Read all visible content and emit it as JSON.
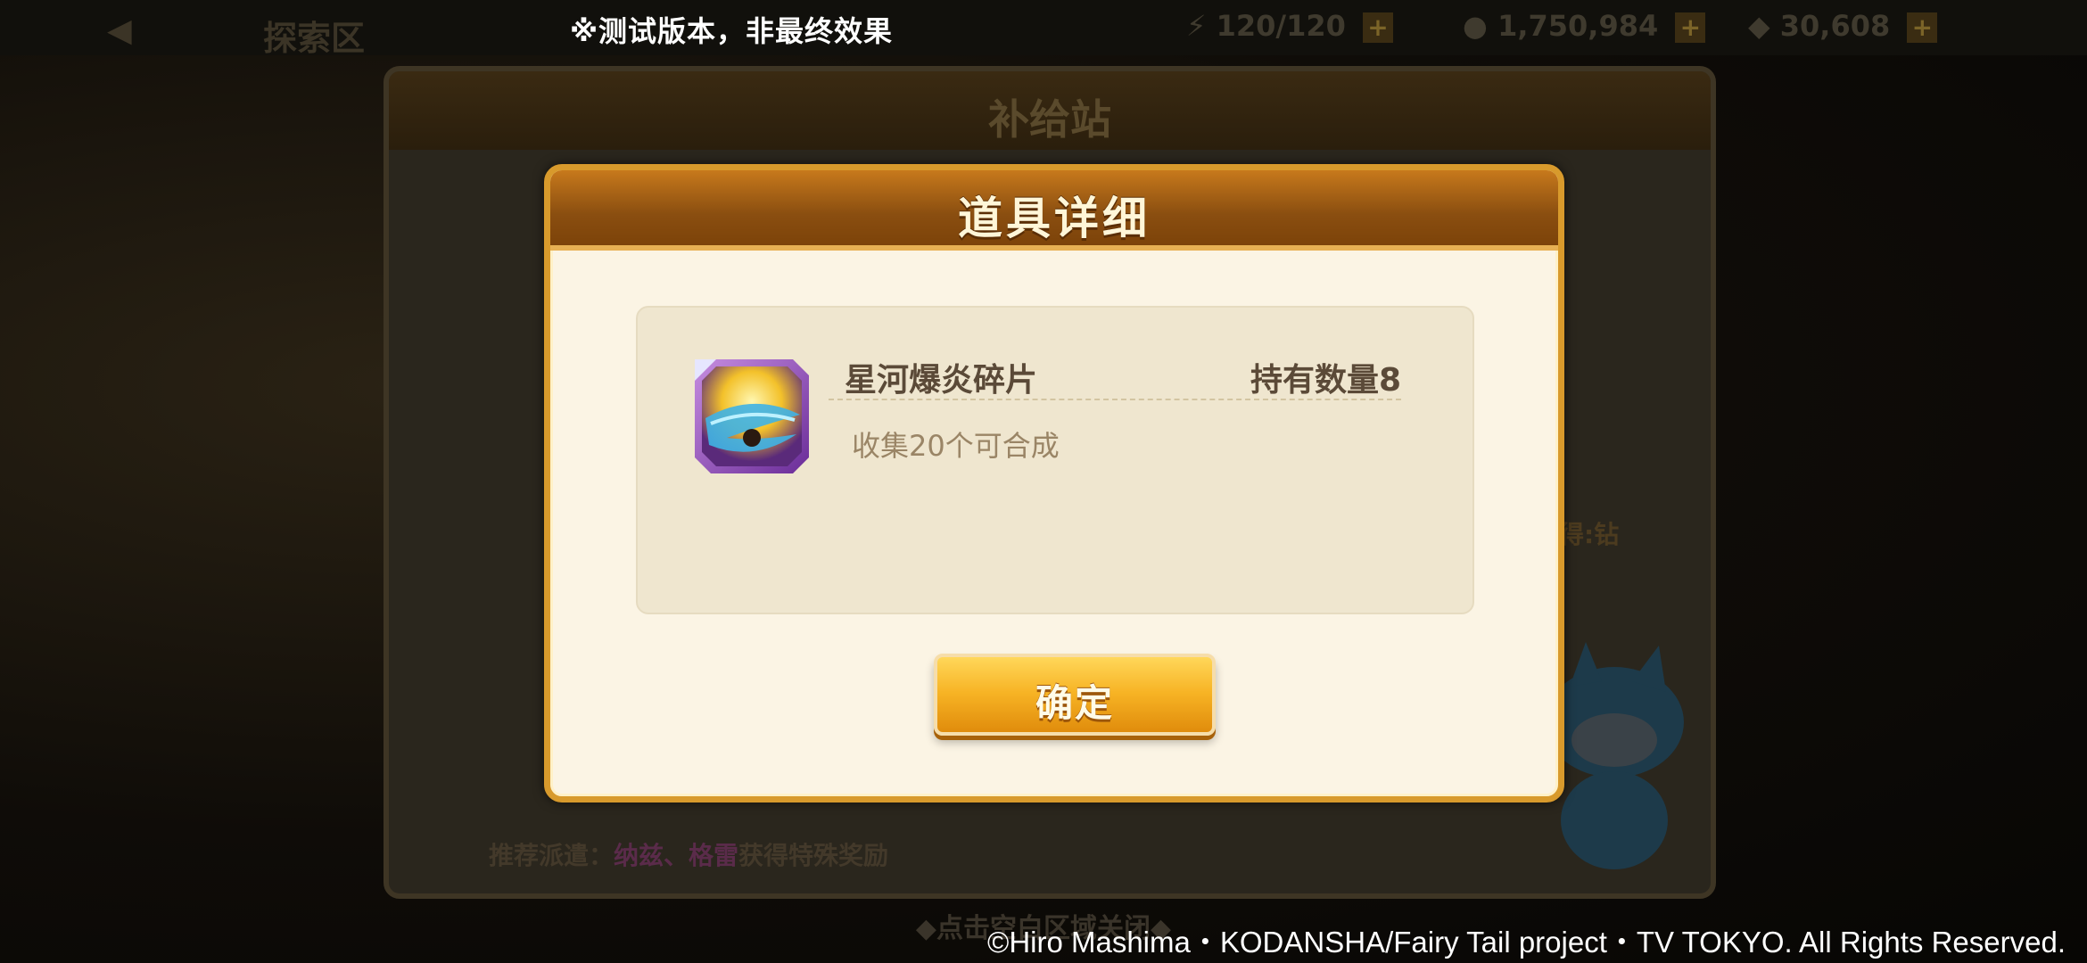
{
  "test_note": "※测试版本，非最终效果",
  "topbar": {
    "title": "探索区",
    "resources": [
      {
        "value": "120/120",
        "icon": "stamina-icon"
      },
      {
        "value": "1,750,984",
        "icon": "coin-icon"
      },
      {
        "value": "30,608",
        "icon": "diamond-icon"
      }
    ]
  },
  "supply": {
    "title": "补给站",
    "recommend_prefix": "推荐派遣：",
    "recommend_names": "纳兹、格雷",
    "recommend_suffix": "获得特殊奖励",
    "side_label": "得:钻"
  },
  "close_hint": "◆点击空白区域关闭◆",
  "dialog": {
    "title": "道具详细",
    "item": {
      "name": "星河爆炎碎片",
      "quantity": "持有数量8",
      "description": "收集20个可合成"
    },
    "confirm_label": "确定"
  },
  "copyright": "©Hiro Mashima・KODANSHA/Fairy Tail project・TV TOKYO. All Rights Reserved.",
  "colors": {
    "dialog_border": "#d89a2c",
    "dialog_header": "#8a4e10",
    "dialog_bg": "#fbf4e4",
    "button_gold": "#f7b324"
  }
}
